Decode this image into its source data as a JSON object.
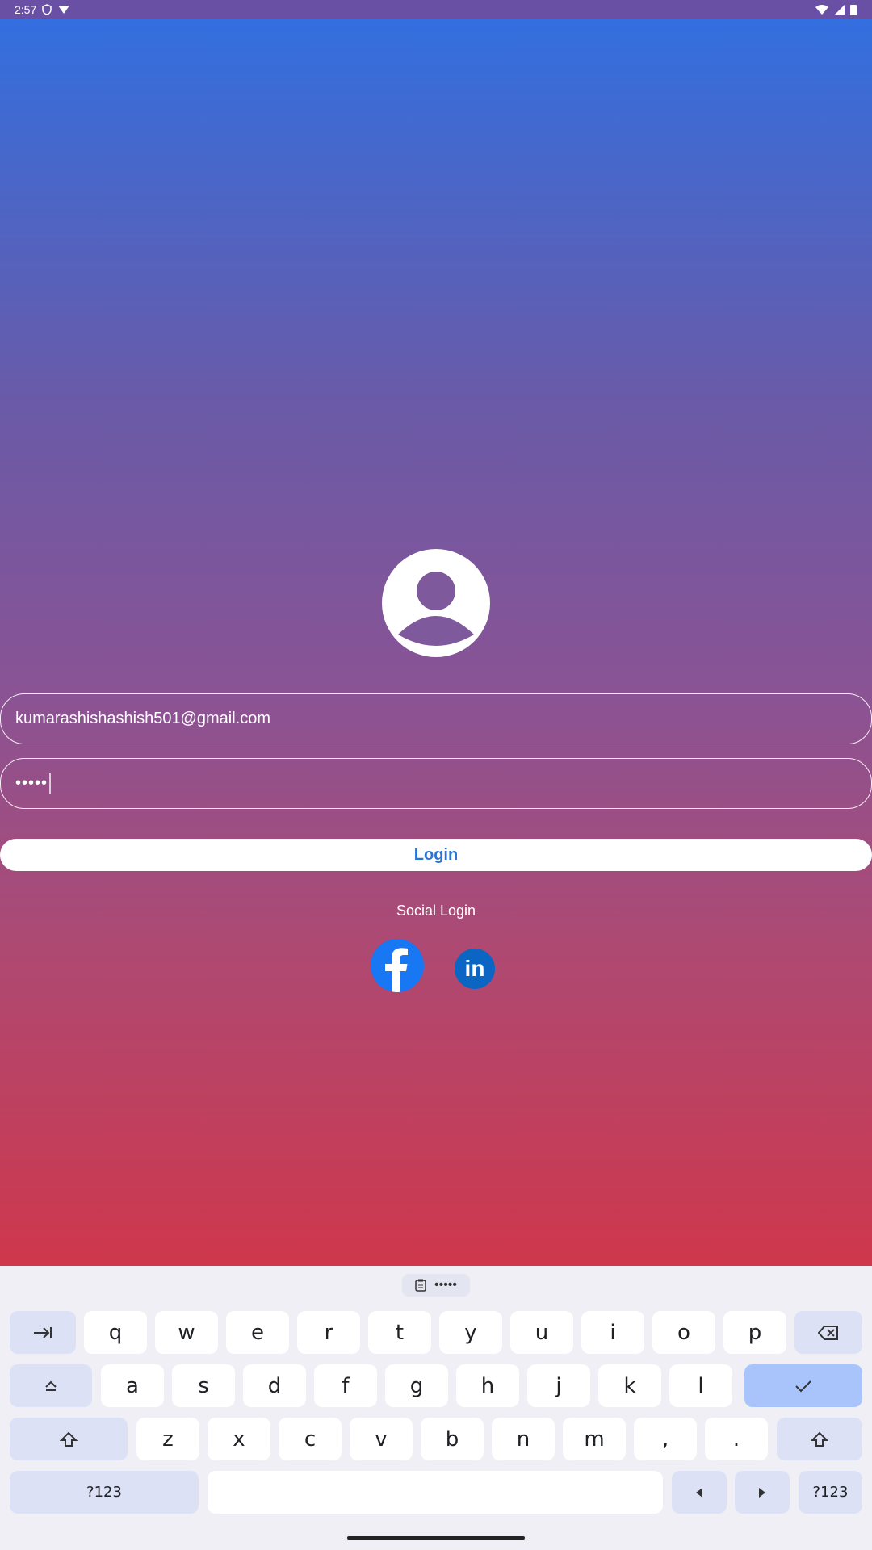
{
  "status_bar": {
    "time": "2:57"
  },
  "login": {
    "email_value": "kumarashishashish501@gmail.com",
    "password_value": "•••••",
    "login_label": "Login",
    "social_label": "Social Login",
    "linkedin_label": "in"
  },
  "keyboard": {
    "suggestion": "•••••",
    "row1": [
      "q",
      "w",
      "e",
      "r",
      "t",
      "y",
      "u",
      "i",
      "o",
      "p"
    ],
    "row2": [
      "a",
      "s",
      "d",
      "f",
      "g",
      "h",
      "j",
      "k",
      "l"
    ],
    "row3": [
      "z",
      "x",
      "c",
      "v",
      "b",
      "n",
      "m",
      ",",
      "."
    ],
    "symbols_label": "?123"
  },
  "colors": {
    "gradient_top": "#3070e2",
    "gradient_bottom": "#cf374c",
    "facebook": "#1877f2",
    "linkedin": "#0a66c2",
    "login_text": "#2a74d8"
  }
}
